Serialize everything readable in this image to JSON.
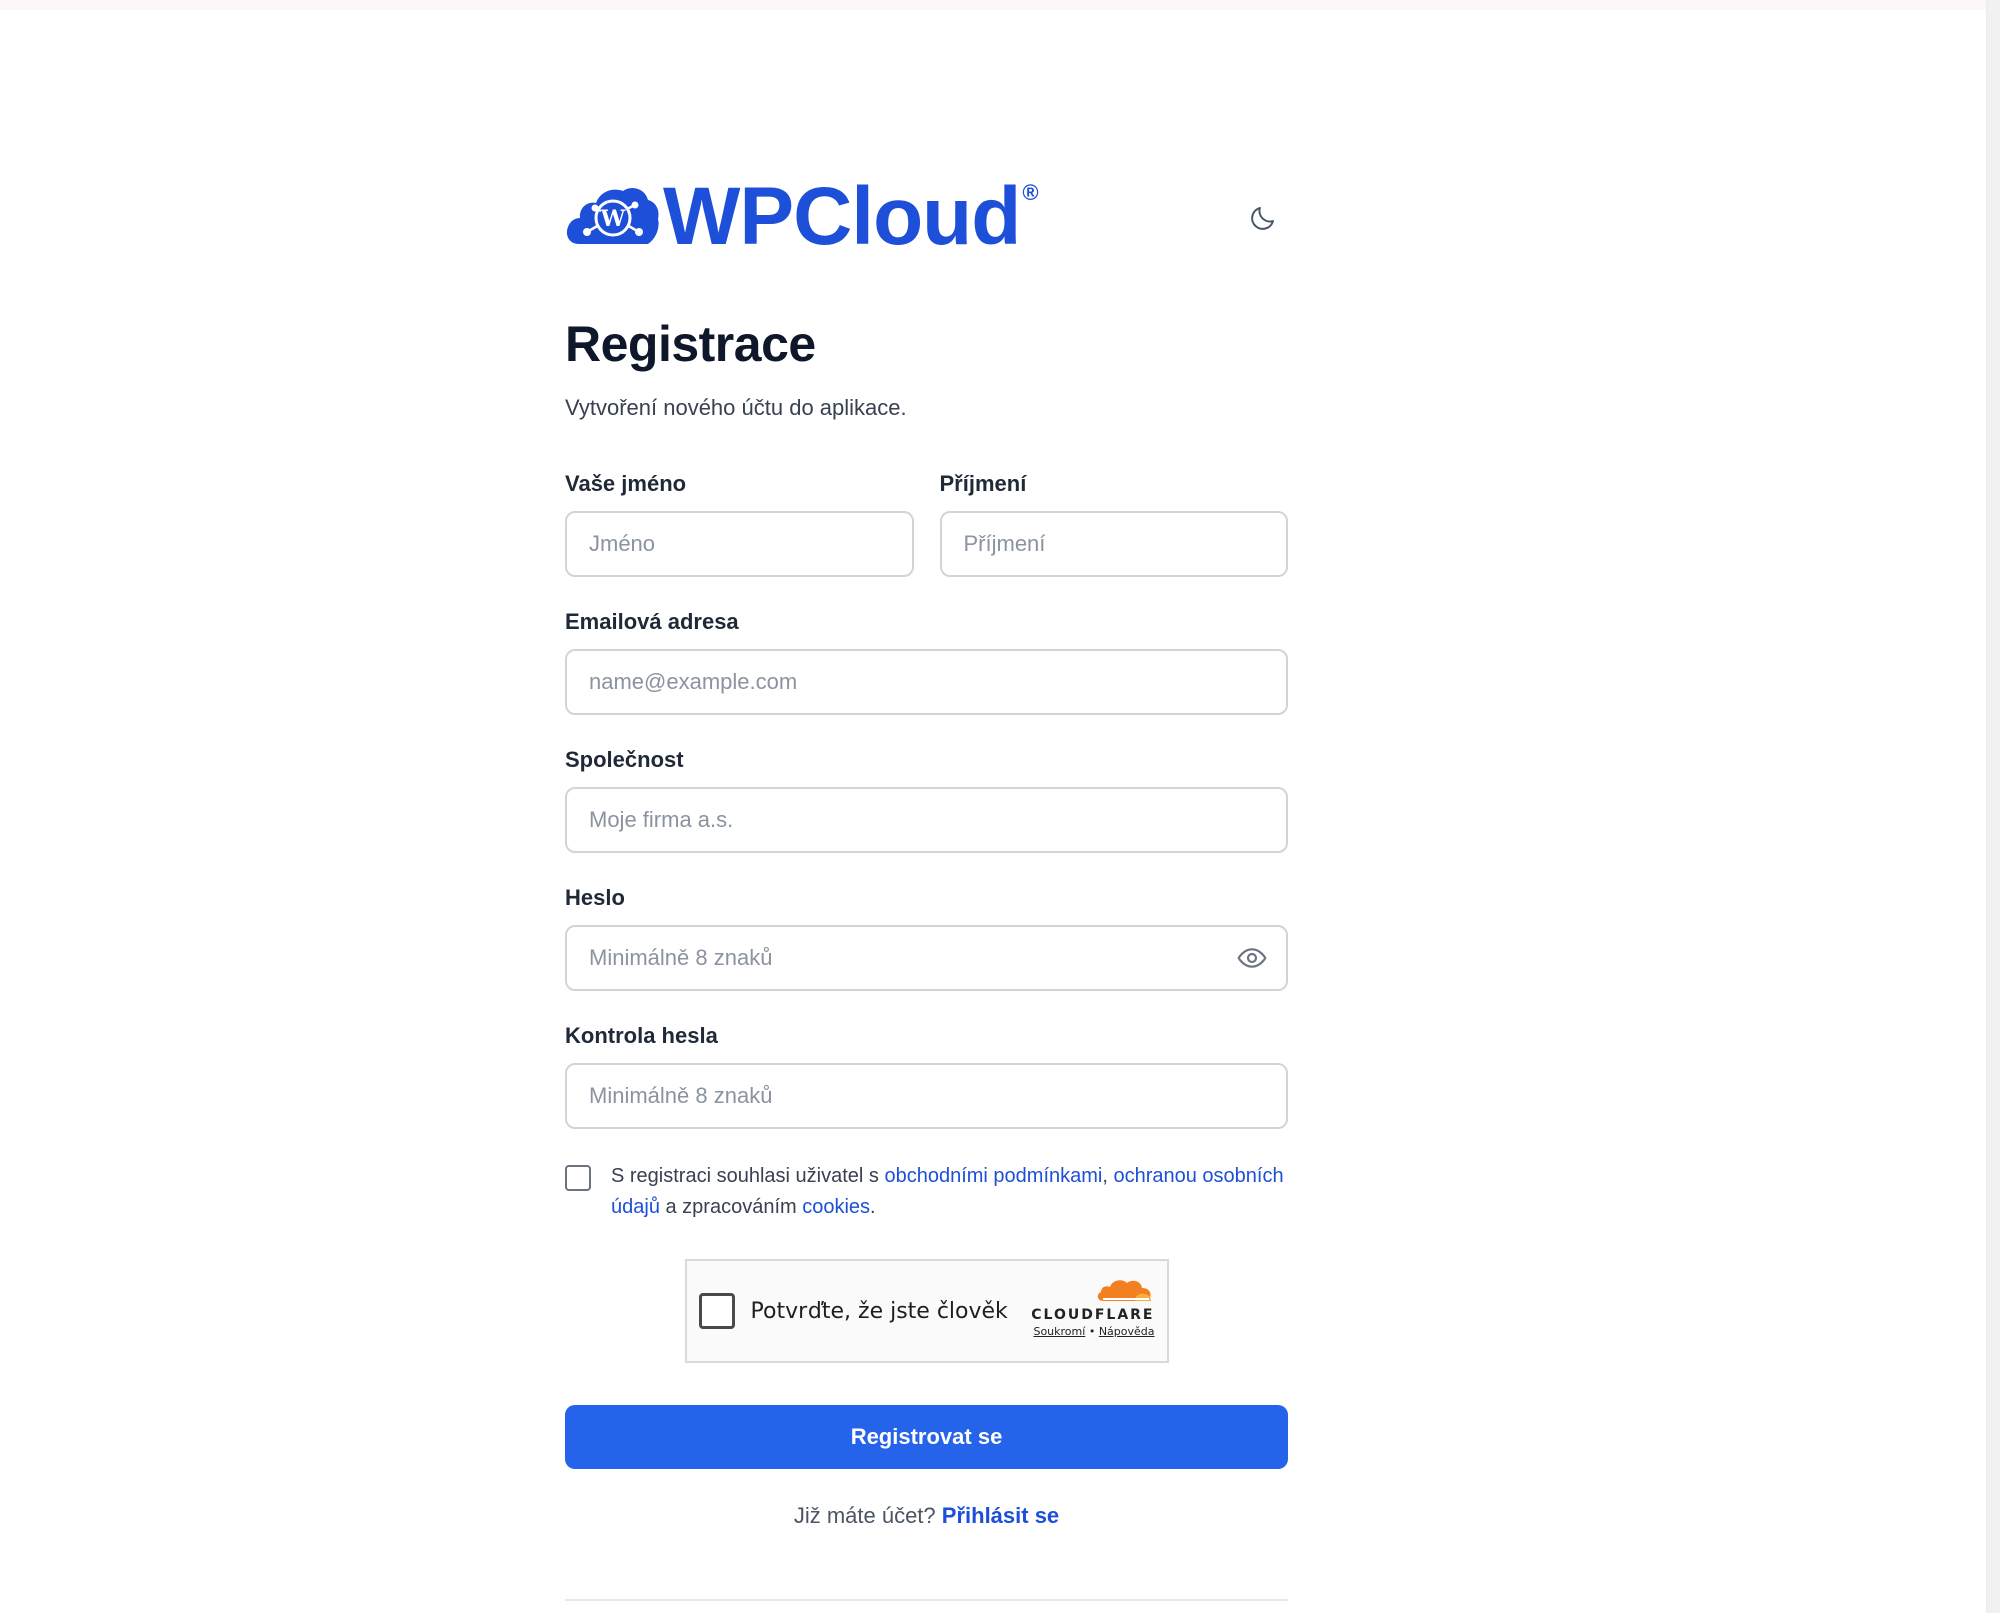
{
  "brand": {
    "name": "WPCloud",
    "reg": "®",
    "color": "#1d4fd8"
  },
  "header": {
    "theme_toggle_icon": "moon-icon"
  },
  "page": {
    "title": "Registrace",
    "subtitle": "Vytvoření nového účtu do aplikace."
  },
  "form": {
    "first_name": {
      "label": "Vaše jméno",
      "placeholder": "Jméno",
      "value": ""
    },
    "last_name": {
      "label": "Příjmení",
      "placeholder": "Příjmení",
      "value": ""
    },
    "email": {
      "label": "Emailová adresa",
      "placeholder": "name@example.com",
      "value": ""
    },
    "company": {
      "label": "Společnost",
      "placeholder": "Moje firma a.s.",
      "value": ""
    },
    "password": {
      "label": "Heslo",
      "placeholder": "Minimálně 8 znaků",
      "value": "",
      "toggle_icon": "eye-icon"
    },
    "password_confirm": {
      "label": "Kontrola hesla",
      "placeholder": "Minimálně 8 znaků",
      "value": ""
    },
    "consent": {
      "checked": false,
      "text_1": "S registraci souhlasi uživatel s ",
      "link_terms": "obchodními podmínkami",
      "text_2": ", ",
      "link_privacy": "ochranou osobních údajů",
      "text_3": " a zpracováním ",
      "link_cookies": "cookies",
      "text_4": "."
    },
    "submit_label": "Registrovat se"
  },
  "captcha": {
    "label": "Potvrďte, že jste člověk",
    "provider": "CLOUDFLARE",
    "privacy_link": "Soukromí",
    "separator": "•",
    "help_link": "Nápověda",
    "brand_color": "#f38020"
  },
  "signin": {
    "prompt": "Již máte účet?",
    "link": "Přihlásit se"
  },
  "colors": {
    "primary": "#2563eb",
    "link": "#1d4fd8"
  }
}
